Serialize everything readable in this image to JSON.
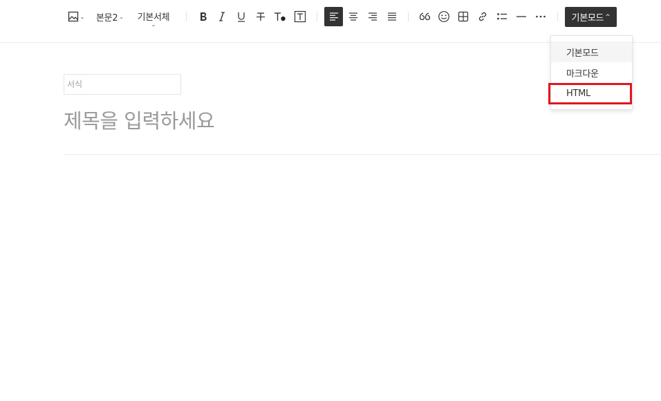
{
  "toolbar": {
    "paragraph_style": "본문2",
    "font_family": "기본서체",
    "mode_button": "기본모드",
    "caret_down": "⌄",
    "caret_up": "^",
    "icons": [
      "image-icon",
      "bold-icon",
      "italic-icon",
      "underline-icon",
      "strikethrough-icon",
      "text-color-icon",
      "text-background-icon",
      "align-left-icon",
      "align-center-icon",
      "align-right-icon",
      "align-justify-icon",
      "quote-icon",
      "emoji-icon",
      "table-icon",
      "link-icon",
      "list-icon",
      "horizontal-rule-icon",
      "more-icon"
    ]
  },
  "mode_menu": {
    "items": [
      {
        "label": "기본모드"
      },
      {
        "label": "마크다운"
      },
      {
        "label": "HTML"
      }
    ]
  },
  "editor": {
    "format_placeholder": "서식",
    "title_placeholder": "제목을 입력하세요"
  },
  "colors": {
    "accent_dark": "#333333",
    "highlight_red": "#e0171d"
  }
}
